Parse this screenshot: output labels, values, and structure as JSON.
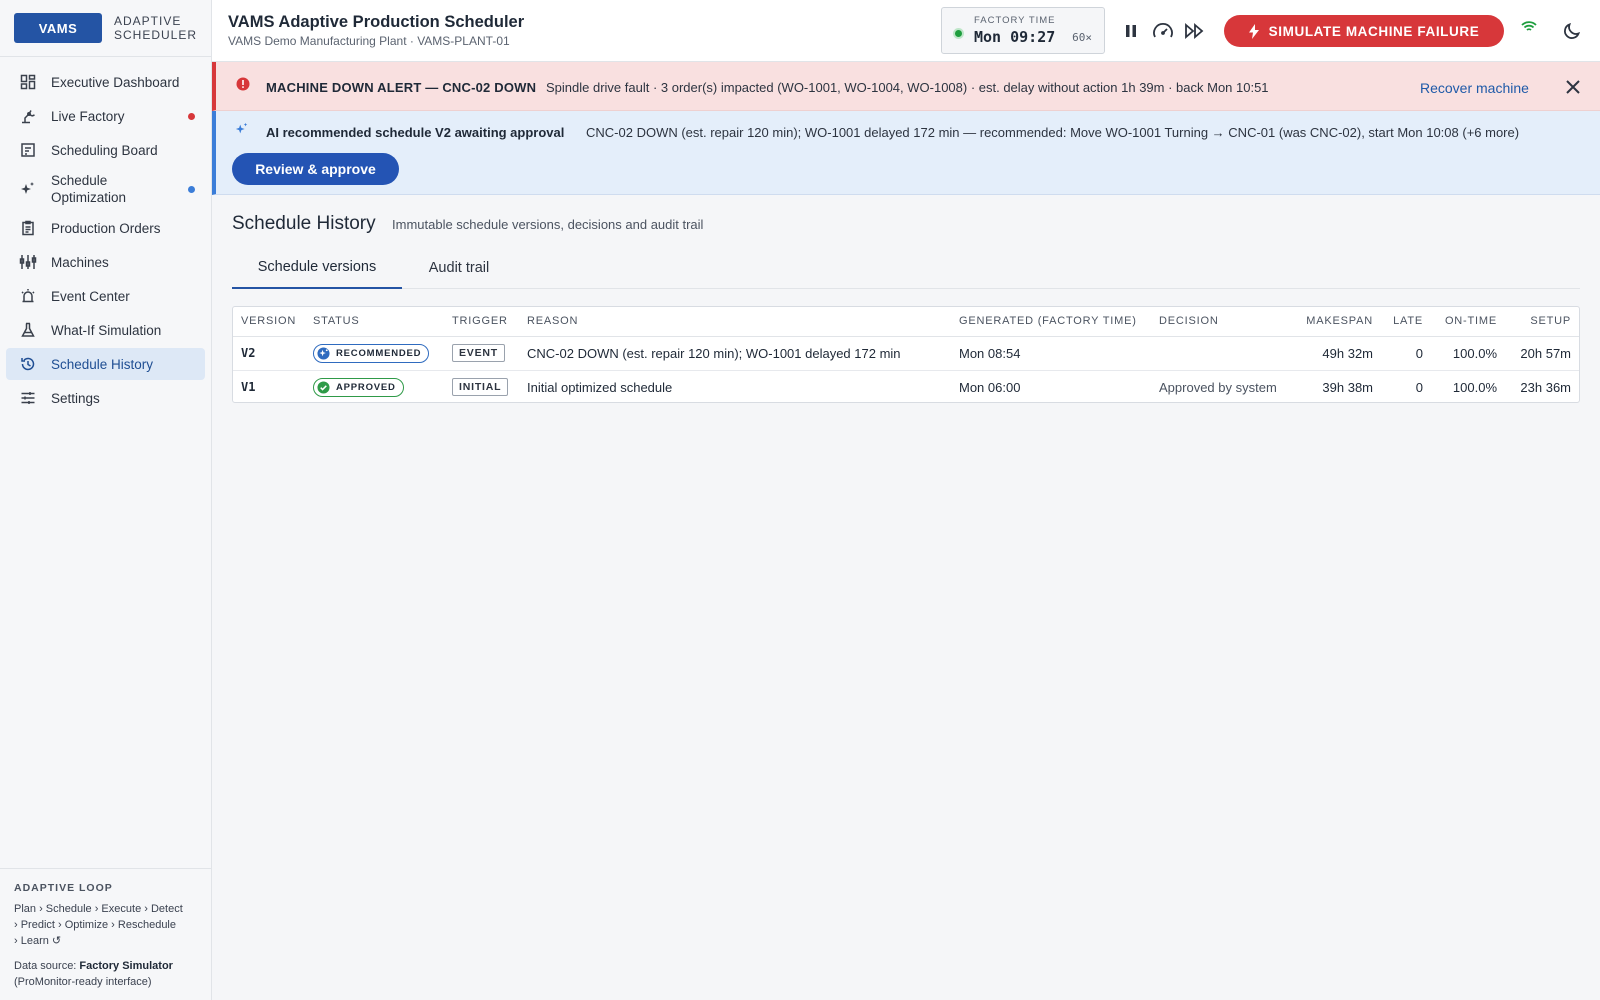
{
  "brand": {
    "logo": "VAMS",
    "line1": "ADAPTIVE",
    "line2": "SCHEDULER"
  },
  "sidebar": {
    "items": [
      {
        "label": "Executive Dashboard",
        "icon": "dashboard-icon"
      },
      {
        "label": "Live Factory",
        "icon": "robot-arm-icon",
        "dot": "#d7373a"
      },
      {
        "label": "Scheduling Board",
        "icon": "board-icon"
      },
      {
        "label": "Schedule Optimization",
        "icon": "sparkle-icon",
        "dot": "#3b7dd8"
      },
      {
        "label": "Production Orders",
        "icon": "clipboard-icon"
      },
      {
        "label": "Machines",
        "icon": "machines-icon"
      },
      {
        "label": "Event Center",
        "icon": "alarm-icon"
      },
      {
        "label": "What-If Simulation",
        "icon": "flask-icon"
      },
      {
        "label": "Schedule History",
        "icon": "history-icon",
        "active": true
      },
      {
        "label": "Settings",
        "icon": "sliders-icon"
      }
    ],
    "footer": {
      "title": "ADAPTIVE LOOP",
      "loop_line1": "Plan › Schedule › Execute › Detect",
      "loop_line2": "› Predict › Optimize › Reschedule",
      "loop_line3": "› Learn ↺",
      "source_prefix": "Data source: ",
      "source_name": "Factory Simulator",
      "source_note": "(ProMonitor-ready interface)"
    }
  },
  "header": {
    "title": "VAMS Adaptive Production Scheduler",
    "subtitle": "VAMS Demo Manufacturing Plant · VAMS-PLANT-01",
    "clock_label": "FACTORY TIME",
    "clock_time": "Mon 09:27",
    "clock_speed": "60×",
    "fail_button": "SIMULATE MACHINE FAILURE"
  },
  "alert_down": {
    "title": "MACHINE DOWN ALERT — CNC-02 DOWN",
    "text": "Spindle drive fault · 3 order(s) impacted (WO-1001, WO-1004, WO-1008) · est. delay without action 1h 39m · back Mon 10:51",
    "action": "Recover machine"
  },
  "alert_ai": {
    "title": "AI recommended schedule V2 awaiting approval",
    "text": "CNC-02 DOWN (est. repair 120 min); WO-1001 delayed 172 min — recommended: Move WO-1001 Turning → CNC-01 (was CNC-02), start Mon 10:08 (+6 more)",
    "button": "Review & approve"
  },
  "page": {
    "title": "Schedule History",
    "subtitle": "Immutable schedule versions, decisions and audit trail",
    "tabs": [
      "Schedule versions",
      "Audit trail"
    ]
  },
  "table": {
    "headers": [
      "VERSION",
      "STATUS",
      "TRIGGER",
      "REASON",
      "GENERATED (FACTORY TIME)",
      "DECISION",
      "MAKESPAN",
      "LATE",
      "ON-TIME",
      "SETUP"
    ],
    "rows": [
      {
        "version": "V2",
        "status": "RECOMMENDED",
        "trigger": "EVENT",
        "reason": "CNC-02 DOWN (est. repair 120 min); WO-1001 delayed 172 min",
        "generated": "Mon 08:54",
        "decision": "",
        "makespan": "49h 32m",
        "late": "0",
        "ontime": "100.0%",
        "setup": "20h 57m"
      },
      {
        "version": "V1",
        "status": "APPROVED",
        "trigger": "INITIAL",
        "reason": "Initial optimized schedule",
        "generated": "Mon 06:00",
        "decision": "Approved by system",
        "makespan": "39h 38m",
        "late": "0",
        "ontime": "100.0%",
        "setup": "23h 36m"
      }
    ]
  },
  "colors": {
    "accent": "#2454a4",
    "danger": "#d7373a",
    "info": "#3b7dd8",
    "success": "#2f9a48"
  }
}
